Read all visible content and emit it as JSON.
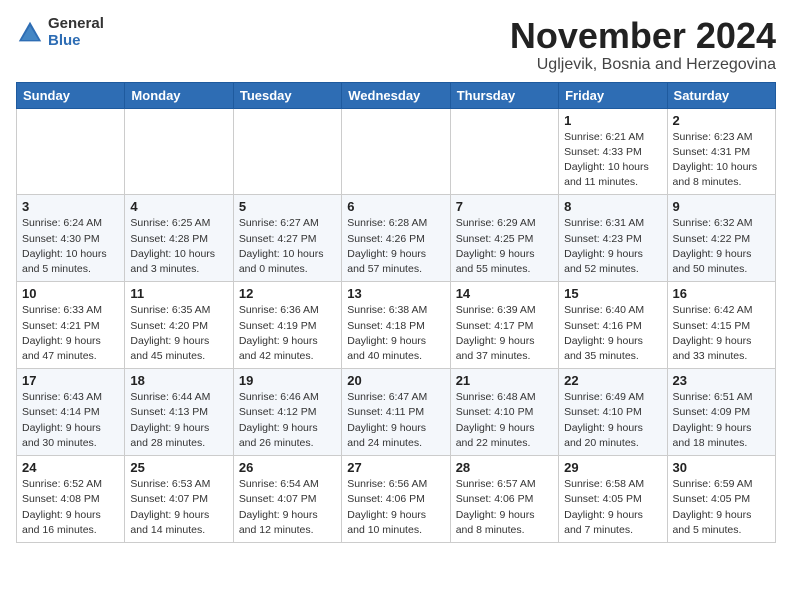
{
  "logo": {
    "general": "General",
    "blue": "Blue"
  },
  "title": "November 2024",
  "location": "Ugljevik, Bosnia and Herzegovina",
  "days_of_week": [
    "Sunday",
    "Monday",
    "Tuesday",
    "Wednesday",
    "Thursday",
    "Friday",
    "Saturday"
  ],
  "weeks": [
    [
      {
        "day": "",
        "info": ""
      },
      {
        "day": "",
        "info": ""
      },
      {
        "day": "",
        "info": ""
      },
      {
        "day": "",
        "info": ""
      },
      {
        "day": "",
        "info": ""
      },
      {
        "day": "1",
        "info": "Sunrise: 6:21 AM\nSunset: 4:33 PM\nDaylight: 10 hours and 11 minutes."
      },
      {
        "day": "2",
        "info": "Sunrise: 6:23 AM\nSunset: 4:31 PM\nDaylight: 10 hours and 8 minutes."
      }
    ],
    [
      {
        "day": "3",
        "info": "Sunrise: 6:24 AM\nSunset: 4:30 PM\nDaylight: 10 hours and 5 minutes."
      },
      {
        "day": "4",
        "info": "Sunrise: 6:25 AM\nSunset: 4:28 PM\nDaylight: 10 hours and 3 minutes."
      },
      {
        "day": "5",
        "info": "Sunrise: 6:27 AM\nSunset: 4:27 PM\nDaylight: 10 hours and 0 minutes."
      },
      {
        "day": "6",
        "info": "Sunrise: 6:28 AM\nSunset: 4:26 PM\nDaylight: 9 hours and 57 minutes."
      },
      {
        "day": "7",
        "info": "Sunrise: 6:29 AM\nSunset: 4:25 PM\nDaylight: 9 hours and 55 minutes."
      },
      {
        "day": "8",
        "info": "Sunrise: 6:31 AM\nSunset: 4:23 PM\nDaylight: 9 hours and 52 minutes."
      },
      {
        "day": "9",
        "info": "Sunrise: 6:32 AM\nSunset: 4:22 PM\nDaylight: 9 hours and 50 minutes."
      }
    ],
    [
      {
        "day": "10",
        "info": "Sunrise: 6:33 AM\nSunset: 4:21 PM\nDaylight: 9 hours and 47 minutes."
      },
      {
        "day": "11",
        "info": "Sunrise: 6:35 AM\nSunset: 4:20 PM\nDaylight: 9 hours and 45 minutes."
      },
      {
        "day": "12",
        "info": "Sunrise: 6:36 AM\nSunset: 4:19 PM\nDaylight: 9 hours and 42 minutes."
      },
      {
        "day": "13",
        "info": "Sunrise: 6:38 AM\nSunset: 4:18 PM\nDaylight: 9 hours and 40 minutes."
      },
      {
        "day": "14",
        "info": "Sunrise: 6:39 AM\nSunset: 4:17 PM\nDaylight: 9 hours and 37 minutes."
      },
      {
        "day": "15",
        "info": "Sunrise: 6:40 AM\nSunset: 4:16 PM\nDaylight: 9 hours and 35 minutes."
      },
      {
        "day": "16",
        "info": "Sunrise: 6:42 AM\nSunset: 4:15 PM\nDaylight: 9 hours and 33 minutes."
      }
    ],
    [
      {
        "day": "17",
        "info": "Sunrise: 6:43 AM\nSunset: 4:14 PM\nDaylight: 9 hours and 30 minutes."
      },
      {
        "day": "18",
        "info": "Sunrise: 6:44 AM\nSunset: 4:13 PM\nDaylight: 9 hours and 28 minutes."
      },
      {
        "day": "19",
        "info": "Sunrise: 6:46 AM\nSunset: 4:12 PM\nDaylight: 9 hours and 26 minutes."
      },
      {
        "day": "20",
        "info": "Sunrise: 6:47 AM\nSunset: 4:11 PM\nDaylight: 9 hours and 24 minutes."
      },
      {
        "day": "21",
        "info": "Sunrise: 6:48 AM\nSunset: 4:10 PM\nDaylight: 9 hours and 22 minutes."
      },
      {
        "day": "22",
        "info": "Sunrise: 6:49 AM\nSunset: 4:10 PM\nDaylight: 9 hours and 20 minutes."
      },
      {
        "day": "23",
        "info": "Sunrise: 6:51 AM\nSunset: 4:09 PM\nDaylight: 9 hours and 18 minutes."
      }
    ],
    [
      {
        "day": "24",
        "info": "Sunrise: 6:52 AM\nSunset: 4:08 PM\nDaylight: 9 hours and 16 minutes."
      },
      {
        "day": "25",
        "info": "Sunrise: 6:53 AM\nSunset: 4:07 PM\nDaylight: 9 hours and 14 minutes."
      },
      {
        "day": "26",
        "info": "Sunrise: 6:54 AM\nSunset: 4:07 PM\nDaylight: 9 hours and 12 minutes."
      },
      {
        "day": "27",
        "info": "Sunrise: 6:56 AM\nSunset: 4:06 PM\nDaylight: 9 hours and 10 minutes."
      },
      {
        "day": "28",
        "info": "Sunrise: 6:57 AM\nSunset: 4:06 PM\nDaylight: 9 hours and 8 minutes."
      },
      {
        "day": "29",
        "info": "Sunrise: 6:58 AM\nSunset: 4:05 PM\nDaylight: 9 hours and 7 minutes."
      },
      {
        "day": "30",
        "info": "Sunrise: 6:59 AM\nSunset: 4:05 PM\nDaylight: 9 hours and 5 minutes."
      }
    ]
  ]
}
